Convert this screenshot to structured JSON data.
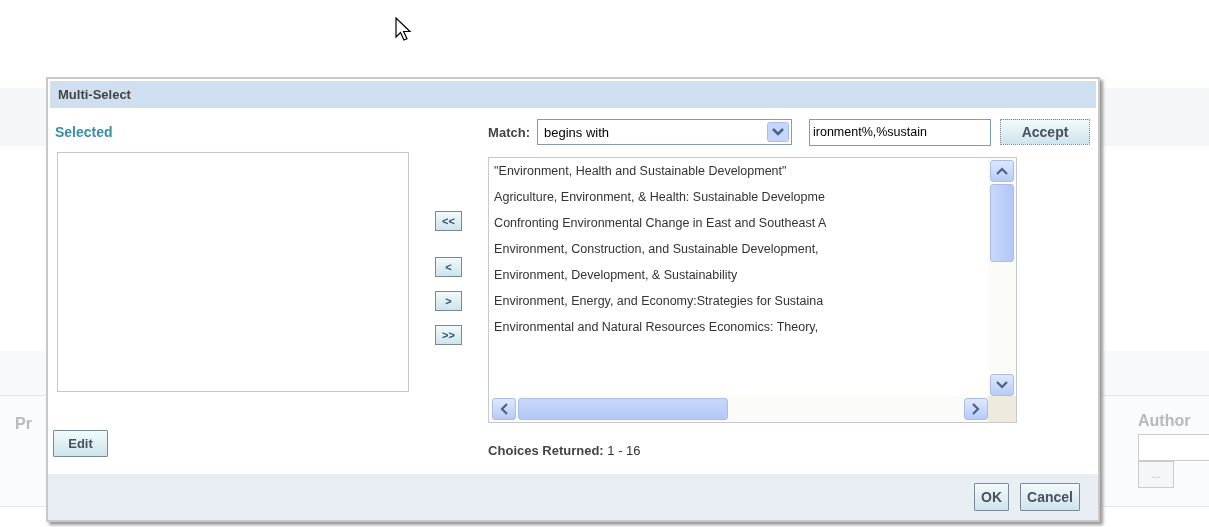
{
  "background": {
    "partial_label": "Pr",
    "author_label": "Author",
    "browse_button": "..."
  },
  "dialog": {
    "title": "Multi-Select",
    "selected_label": "Selected",
    "match_label": "Match:",
    "match_mode": "begins with",
    "search_value": "ironment%,%sustain",
    "accept_button": "Accept",
    "move_buttons": [
      "<<",
      "<",
      ">",
      ">>"
    ],
    "choices": [
      "\"Environment, Health and Sustainable Development\"",
      "Agriculture, Environment, & Health: Sustainable Developme",
      "Confronting Environmental Change in East and Southeast A",
      "Environment, Construction, and Sustainable Development,",
      "Environment, Development, & Sustainability",
      "Environment, Energy, and Economy:Strategies for Sustaina",
      "Environmental and Natural Resources Economics: Theory,"
    ],
    "edit_button": "Edit",
    "choices_returned_label": "Choices Returned:",
    "choices_returned_value": "1 - 16",
    "buttons": [
      "OK",
      "Cancel"
    ]
  }
}
